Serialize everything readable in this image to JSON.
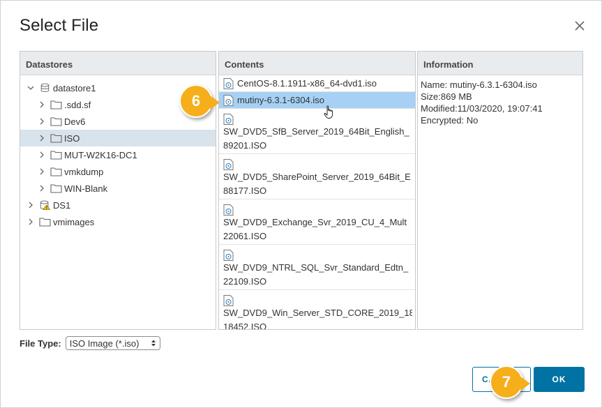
{
  "dialog": {
    "title": "Select File"
  },
  "datastores": {
    "header": "Datastores",
    "items": [
      {
        "label": "datastore1",
        "icon": "database-icon",
        "expanded": true,
        "level": 0
      },
      {
        "label": ".sdd.sf",
        "icon": "folder-icon",
        "level": 1
      },
      {
        "label": "Dev6",
        "icon": "folder-icon",
        "level": 1
      },
      {
        "label": "ISO",
        "icon": "folder-icon",
        "level": 1,
        "selected": true
      },
      {
        "label": "MUT-W2K16-DC1",
        "icon": "folder-icon",
        "level": 1
      },
      {
        "label": "vmkdump",
        "icon": "folder-icon",
        "level": 1
      },
      {
        "label": "WIN-Blank",
        "icon": "folder-icon",
        "level": 1
      },
      {
        "label": "DS1",
        "icon": "database-warning-icon",
        "level": 0
      },
      {
        "label": "vmimages",
        "icon": "folder-icon",
        "level": 0
      }
    ]
  },
  "contents": {
    "header": "Contents",
    "files": [
      {
        "line1": "CentOS-8.1.1911-x86_64-dvd1.iso"
      },
      {
        "line1": "mutiny-6.3.1-6304.iso",
        "selected": true
      },
      {
        "line1": "SW_DVD5_SfB_Server_2019_64Bit_English_",
        "line2": "89201.ISO"
      },
      {
        "line1": "SW_DVD5_SharePoint_Server_2019_64Bit_E",
        "line2": "88177.ISO"
      },
      {
        "line1": "SW_DVD9_Exchange_Svr_2019_CU_4_Mult",
        "line2": "22061.ISO"
      },
      {
        "line1": "SW_DVD9_NTRL_SQL_Svr_Standard_Edtn_",
        "line2": "22109.ISO"
      },
      {
        "line1": "SW_DVD9_Win_Server_STD_CORE_2019_18",
        "line2": "18452.ISO"
      }
    ]
  },
  "information": {
    "header": "Information",
    "name": "Name: mutiny-6.3.1-6304.iso",
    "size": "Size:869 MB",
    "modified": "Modified:11/03/2020, 19:07:41",
    "encrypted": "Encrypted: No"
  },
  "filetype": {
    "label": "File Type:",
    "selected": "ISO Image (*.iso)"
  },
  "buttons": {
    "cancel": "CANCEL",
    "ok": "OK"
  },
  "callouts": {
    "step6": "6",
    "step7": "7"
  },
  "colors": {
    "accent": "#0072a3",
    "selection_row": "#a6d1f5",
    "tree_selection": "#d8e3ec",
    "callout": "#f6ae1b"
  }
}
